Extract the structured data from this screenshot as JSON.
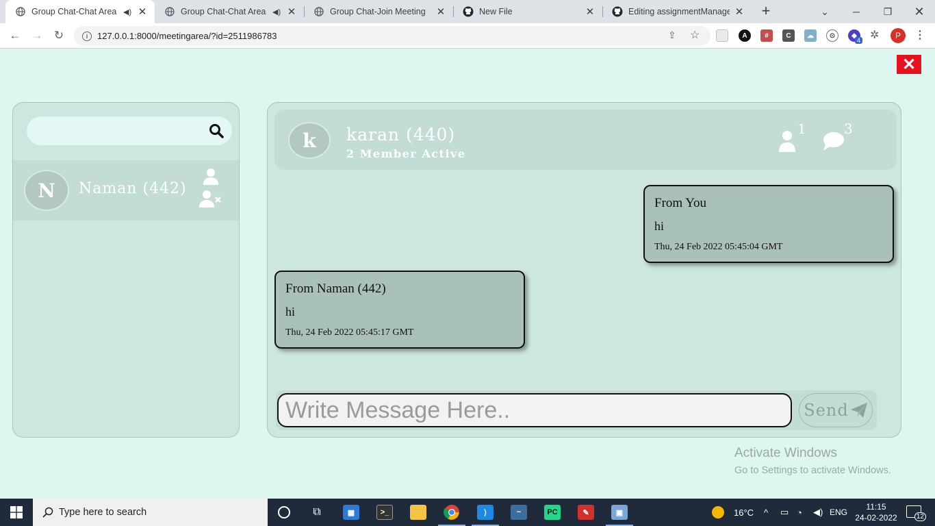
{
  "browser": {
    "tabs": [
      {
        "title": "Group Chat-Chat Area",
        "icon": "globe-icon",
        "audio": true,
        "active": true
      },
      {
        "title": "Group Chat-Chat Area",
        "icon": "globe-icon",
        "audio": true,
        "active": false
      },
      {
        "title": "Group Chat-Join Meeting",
        "icon": "globe-icon",
        "audio": false,
        "active": false
      },
      {
        "title": "New File",
        "icon": "github-icon",
        "audio": false,
        "active": false
      },
      {
        "title": "Editing assignmentManagem",
        "icon": "github-icon",
        "audio": false,
        "active": false
      }
    ],
    "url": "127.0.0.1:8000/meetingarea/?id=2511986783",
    "profile_initial": "P",
    "extension_badge": "4"
  },
  "page": {
    "close_label": "✕",
    "search": {
      "placeholder": "",
      "icon": "search-icon"
    },
    "members": [
      {
        "initial": "N",
        "name": "Naman (442)"
      }
    ],
    "chat": {
      "avatar_initial": "k",
      "title": "karan (440)",
      "subtitle": "2 Member Active",
      "members_count": "1",
      "messages_count": "3"
    },
    "messages": [
      {
        "from": "From You",
        "text": "hi",
        "time": "Thu, 24 Feb 2022 05:45:04 GMT",
        "align": "right"
      },
      {
        "from": "From Naman (442)",
        "text": "hi",
        "time": "Thu, 24 Feb 2022 05:45:17 GMT",
        "align": "left"
      }
    ],
    "composer": {
      "placeholder": "Write Message Here..",
      "send_label": "Send"
    },
    "watermark": {
      "line1": "Activate Windows",
      "line2": "Go to Settings to activate Windows."
    }
  },
  "taskbar": {
    "search_placeholder": "Type here to search",
    "weather": "16°C",
    "language": "ENG",
    "time": "11:15",
    "date": "24-02-2022",
    "notifications": "12"
  },
  "colors": {
    "page_bg": "#ddf7f0",
    "panel_bg": "#cde6df",
    "bubble_bg": "#a9c0bb",
    "close_red": "#e8101a",
    "taskbar_bg": "#1f2b3a"
  }
}
